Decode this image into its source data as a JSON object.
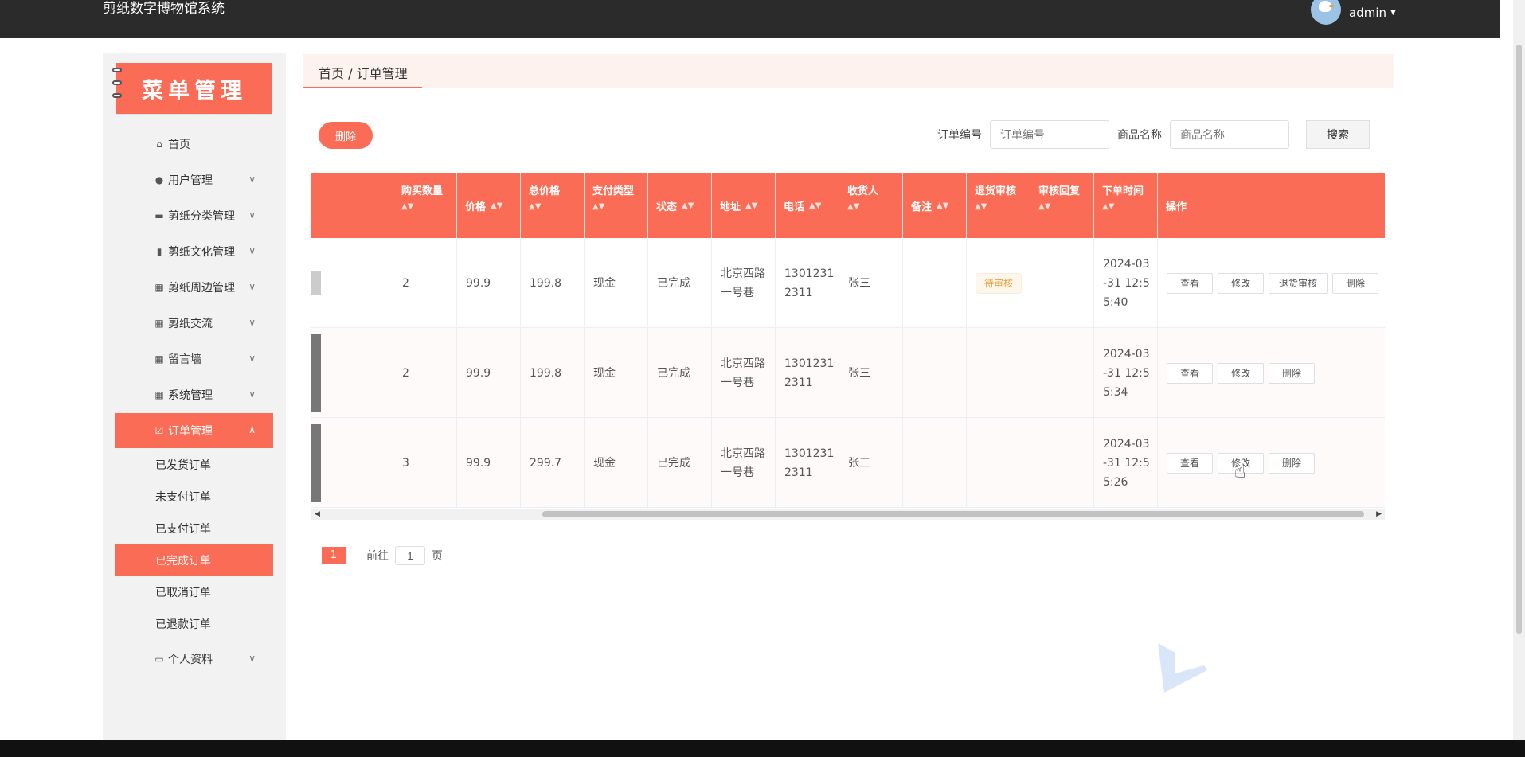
{
  "app": {
    "title": "剪纸数字博物馆系统",
    "user": "admin"
  },
  "sidebar": {
    "banner": "菜单管理",
    "items": [
      {
        "label": "首页",
        "icon": "home-icon"
      },
      {
        "label": "用户管理",
        "icon": "user-icon"
      },
      {
        "label": "剪纸分类管理",
        "icon": "monitor-icon"
      },
      {
        "label": "剪纸文化管理",
        "icon": "chart-icon"
      },
      {
        "label": "剪纸周边管理",
        "icon": "grid-icon"
      },
      {
        "label": "剪纸交流",
        "icon": "grid-icon"
      },
      {
        "label": "留言墙",
        "icon": "grid-icon"
      },
      {
        "label": "系统管理",
        "icon": "grid-icon"
      },
      {
        "label": "订单管理",
        "icon": "checkbox-icon"
      }
    ],
    "subitems": [
      "已发货订单",
      "未支付订单",
      "已支付订单",
      "已完成订单",
      "已取消订单",
      "已退款订单"
    ],
    "last_item": {
      "label": "个人资料",
      "icon": "card-icon"
    }
  },
  "breadcrumb": "首页 / 订单管理",
  "toolbar": {
    "delete_label": "删除",
    "order_no_label": "订单编号",
    "order_no_placeholder": "订单编号",
    "product_name_label": "商品名称",
    "product_name_placeholder": "商品名称",
    "search_label": "搜索"
  },
  "table": {
    "headers": [
      "购买数量",
      "价格",
      "总价格",
      "支付类型",
      "状态",
      "地址",
      "电话",
      "收货人",
      "备注",
      "退货审核",
      "审核回复",
      "下单时间",
      "操作"
    ],
    "rows": [
      {
        "qty": "2",
        "price": "99.9",
        "total": "199.8",
        "pay": "现金",
        "status": "已完成",
        "addr1": "北京西路",
        "addr2": "一号巷",
        "phone1": "1301231",
        "phone2": "2311",
        "receiver": "张三",
        "note": "",
        "review": "待审核",
        "reply": "",
        "time1": "2024-03",
        "time2": "-31 12:5",
        "time3": "5:40",
        "ops": [
          "查看",
          "修改",
          "退货审核",
          "删除"
        ]
      },
      {
        "qty": "2",
        "price": "99.9",
        "total": "199.8",
        "pay": "现金",
        "status": "已完成",
        "addr1": "北京西路",
        "addr2": "一号巷",
        "phone1": "1301231",
        "phone2": "2311",
        "receiver": "张三",
        "note": "",
        "review": "",
        "reply": "",
        "time1": "2024-03",
        "time2": "-31 12:5",
        "time3": "5:34",
        "ops": [
          "查看",
          "修改",
          "删除"
        ]
      },
      {
        "qty": "3",
        "price": "99.9",
        "total": "299.7",
        "pay": "现金",
        "status": "已完成",
        "addr1": "北京西路",
        "addr2": "一号巷",
        "phone1": "1301231",
        "phone2": "2311",
        "receiver": "张三",
        "note": "",
        "review": "",
        "reply": "",
        "time1": "2024-03",
        "time2": "-31 12:5",
        "time3": "5:26",
        "ops": [
          "查看",
          "修改",
          "删除"
        ]
      }
    ]
  },
  "pagination": {
    "current": "1",
    "goto_prefix": "前往",
    "goto_value": "1",
    "goto_suffix": "页"
  },
  "colors": {
    "accent": "#fa6c55",
    "topbar": "#2b2b2b"
  }
}
